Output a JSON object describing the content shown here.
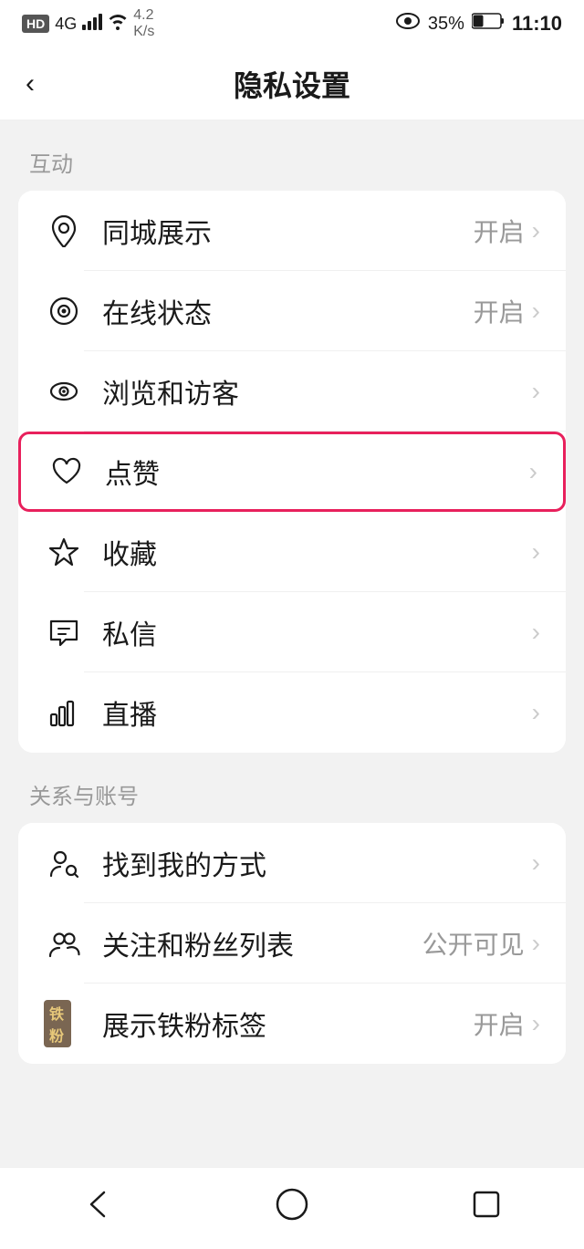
{
  "statusBar": {
    "left": "HD 4G",
    "network": "4.2 K/s",
    "battery": "35%",
    "time": "11:10"
  },
  "header": {
    "back": "<",
    "title": "隐私设置"
  },
  "sections": [
    {
      "label": "互动",
      "items": [
        {
          "id": "tongcheng",
          "icon": "location",
          "text": "同城展示",
          "value": "开启",
          "arrow": ">"
        },
        {
          "id": "zaixian",
          "icon": "online",
          "text": "在线状态",
          "value": "开启",
          "arrow": ">"
        },
        {
          "id": "liulan",
          "icon": "eye",
          "text": "浏览和访客",
          "value": "",
          "arrow": ">"
        },
        {
          "id": "dianzan",
          "icon": "heart",
          "text": "点赞",
          "value": "",
          "arrow": ">",
          "highlighted": true
        },
        {
          "id": "shoucang",
          "icon": "star",
          "text": "收藏",
          "value": "",
          "arrow": ">"
        },
        {
          "id": "sixin",
          "icon": "message",
          "text": "私信",
          "value": "",
          "arrow": ">"
        },
        {
          "id": "zhibo",
          "icon": "bar",
          "text": "直播",
          "value": "",
          "arrow": ">"
        }
      ]
    },
    {
      "label": "关系与账号",
      "items": [
        {
          "id": "zhaodao",
          "icon": "person-search",
          "text": "找到我的方式",
          "value": "",
          "arrow": ">"
        },
        {
          "id": "guanzhu",
          "icon": "persons",
          "text": "关注和粉丝列表",
          "value": "公开可见",
          "arrow": ">"
        },
        {
          "id": "tiefan",
          "icon": "tiefan",
          "text": "展示铁粉标签",
          "value": "开启",
          "arrow": ">"
        }
      ]
    }
  ],
  "bottomNav": {
    "back": "back",
    "home": "home",
    "square": "square"
  }
}
